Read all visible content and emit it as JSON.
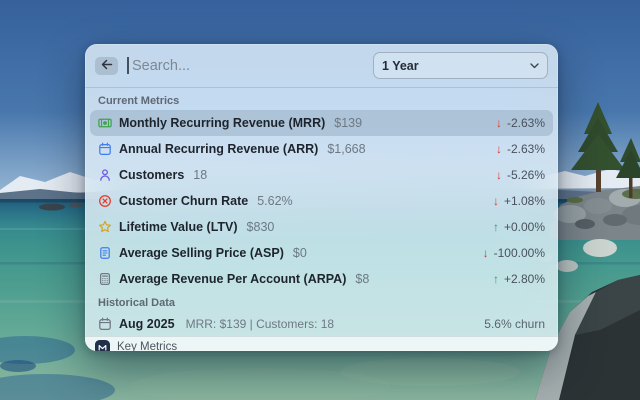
{
  "window": {
    "search_placeholder": "Search...",
    "time_range": "1 Year"
  },
  "sections": {
    "current": "Current Metrics",
    "historical": "Historical Data"
  },
  "metrics": [
    {
      "icon": "banknote-icon",
      "icon_color": "#3fa34d",
      "label": "Monthly Recurring Revenue (MRR)",
      "value": "$139",
      "trend_direction": "down",
      "trend_value": "-2.63%",
      "selected": true
    },
    {
      "icon": "calendar-icon",
      "icon_color": "#3f7ef0",
      "label": "Annual Recurring Revenue (ARR)",
      "value": "$1,668",
      "trend_direction": "down",
      "trend_value": "-2.63%",
      "selected": false
    },
    {
      "icon": "person-icon",
      "icon_color": "#6a5be2",
      "label": "Customers",
      "value": "18",
      "trend_direction": "down",
      "trend_value": "-5.26%",
      "selected": false
    },
    {
      "icon": "x-circle-icon",
      "icon_color": "#e23c2e",
      "label": "Customer Churn Rate",
      "value": "5.62%",
      "trend_direction": "down",
      "trend_value": "+1.08%",
      "selected": false
    },
    {
      "icon": "star-icon",
      "icon_color": "#d7a31c",
      "label": "Lifetime Value (LTV)",
      "value": "$830",
      "trend_direction": "up",
      "trend_value": "+0.00%",
      "selected": false
    },
    {
      "icon": "document-icon",
      "icon_color": "#3f7ef0",
      "label": "Average Selling Price (ASP)",
      "value": "$0",
      "trend_direction": "down",
      "trend_value": "-100.00%",
      "selected": false
    },
    {
      "icon": "calculator-icon",
      "icon_color": "#707a85",
      "label": "Average Revenue Per Account (ARPA)",
      "value": "$8",
      "trend_direction": "up",
      "trend_value": "+2.80%",
      "selected": false
    }
  ],
  "historical": [
    {
      "icon": "calendar-icon",
      "icon_color": "#6e7781",
      "label": "Aug 2025",
      "detail": "MRR: $139 | Customers: 18",
      "right": "5.6% churn"
    }
  ],
  "footer": {
    "label": "Key Metrics"
  },
  "colors": {
    "trend_up": "#2e9e5b",
    "trend_down": "#d83a2a"
  }
}
